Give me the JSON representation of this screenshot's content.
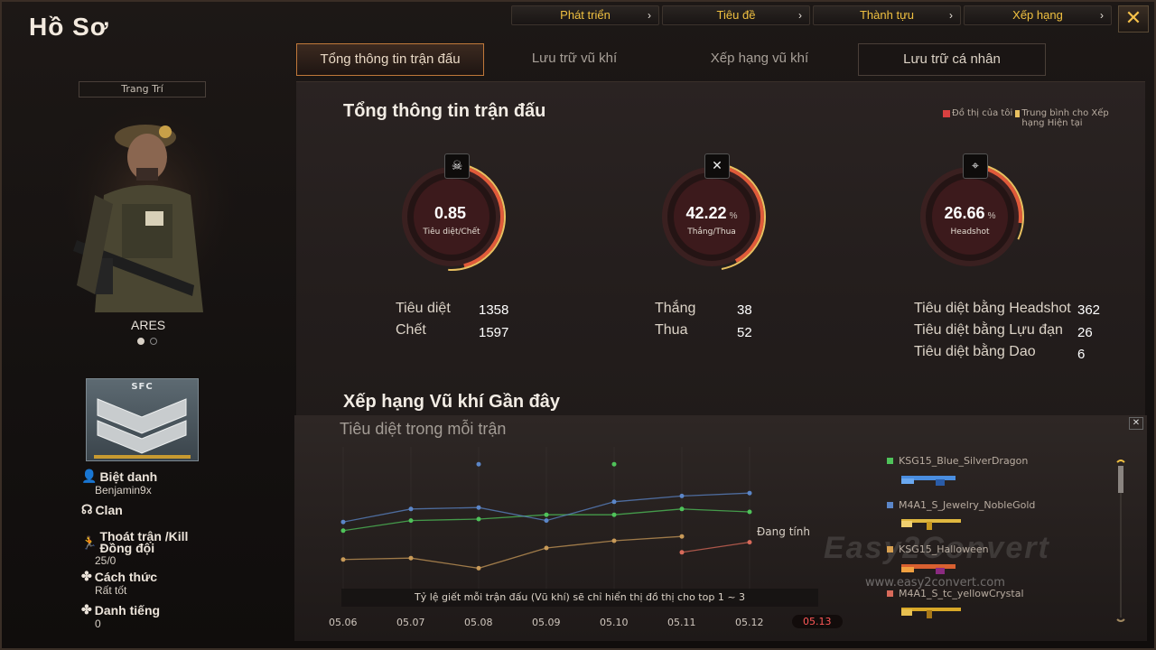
{
  "window": {
    "title": "Hồ Sơ",
    "close_label": "✕"
  },
  "top_nav": [
    {
      "label": "Phát triển"
    },
    {
      "label": "Tiêu đề"
    },
    {
      "label": "Thành tựu"
    },
    {
      "label": "Xếp hạng"
    }
  ],
  "tabs": [
    {
      "label": "Tổng thông tin trận đấu",
      "active": true
    },
    {
      "label": "Lưu trữ vũ khí",
      "active": false
    },
    {
      "label": "Xếp hạng vũ khí",
      "active": false
    },
    {
      "label": "Lưu trữ cá nhân",
      "active": false
    }
  ],
  "profile": {
    "decoration_label": "Trang Trí",
    "character_name": "ARES",
    "rank_badge": "SFC",
    "nickname_label": "Biệt danh",
    "nickname": "Benjamin9x",
    "clan_label": "Clan",
    "quit_label": "Thoát trận /Kill Đồng đội",
    "quit_value": "25/0",
    "manner_label": "Cách thức",
    "manner_value": "Rất tốt",
    "fame_label": "Danh tiếng",
    "fame_value": "0"
  },
  "summary": {
    "title": "Tổng thông tin trận đấu",
    "legend_mine": "Đồ thị của tôi",
    "legend_avg": "Trung bình cho Xếp hạng Hiện tại",
    "gauges": [
      {
        "value": "0.85",
        "suffix": "",
        "label": "Tiêu diệt/Chết",
        "icon": "skull-icon",
        "glyph": "☠",
        "fill": 0.46
      },
      {
        "value": "42.22",
        "suffix": "%",
        "label": "Thắng/Thua",
        "icon": "crossed-guns-icon",
        "glyph": "✕",
        "fill": 0.42
      },
      {
        "value": "26.66",
        "suffix": "%",
        "label": "Headshot",
        "icon": "rifle-scope-icon",
        "glyph": "⌖",
        "fill": 0.27
      }
    ],
    "kill_label": "Tiêu diệt",
    "kill_value": "1358",
    "death_label": "Chết",
    "death_value": "1597",
    "win_label": "Thắng",
    "win_value": "38",
    "lose_label": "Thua",
    "lose_value": "52",
    "hs_label": "Tiêu diệt bằng Headshot",
    "hs_value": "362",
    "grenade_label": "Tiêu diệt bằng Lựu đạn",
    "grenade_value": "26",
    "knife_label": "Tiêu diệt bằng Dao",
    "knife_value": "6"
  },
  "weapons": {
    "title": "Xếp hạng Vũ khí Gần đây",
    "chart_title": "Tiêu diệt trong mỗi trận",
    "pending_label": "Đang tính",
    "note": "Tỷ lệ giết mỗi trận đấu (Vũ khí) sẽ chỉ hiển thị đồ thị cho top 1 ~ 3",
    "list": [
      {
        "name": "KSG15_Blue_SilverDragon",
        "color": "#4fc35a"
      },
      {
        "name": "M4A1_S_Jewelry_NobleGold",
        "color": "#5b86c8"
      },
      {
        "name": "KSG15_Halloween",
        "color": "#d8a050"
      },
      {
        "name": "M4A1_S_tc_yellowCrystal",
        "color": "#d86a5a"
      }
    ]
  },
  "watermark": {
    "brand": "Easy2Convert",
    "url": "www.easy2convert.com"
  },
  "chart_data": {
    "type": "line",
    "title": "Tiêu diệt trong mỗi trận",
    "x": [
      "05.06",
      "05.07",
      "05.08",
      "05.09",
      "05.10",
      "05.11",
      "05.12",
      "05.13"
    ],
    "current_x": "05.13",
    "ylim": [
      0,
      10
    ],
    "series": [
      {
        "name": "KSG15_Blue_SilverDragon",
        "color": "#4fc35a",
        "values": [
          4.2,
          4.9,
          5.0,
          5.3,
          5.3,
          5.7,
          5.5,
          null
        ]
      },
      {
        "name": "M4A1_S_Jewelry_NobleGold",
        "color": "#5b86c8",
        "values": [
          4.8,
          5.7,
          5.8,
          4.9,
          6.2,
          6.6,
          6.8,
          null
        ]
      },
      {
        "name": "KSG15_Halloween",
        "color": "#c89a58",
        "values": [
          2.2,
          2.3,
          1.6,
          3.0,
          3.5,
          3.8,
          null,
          null
        ]
      },
      {
        "name": "M4A1_S_tc_yellowCrystal",
        "color": "#d86a5a",
        "values": [
          null,
          null,
          null,
          null,
          null,
          2.7,
          3.4,
          null
        ]
      }
    ],
    "outliers": [
      {
        "x": "05.08",
        "y": 8.8,
        "color": "#5b86c8"
      },
      {
        "x": "05.10",
        "y": 8.8,
        "color": "#4fc35a"
      }
    ]
  }
}
